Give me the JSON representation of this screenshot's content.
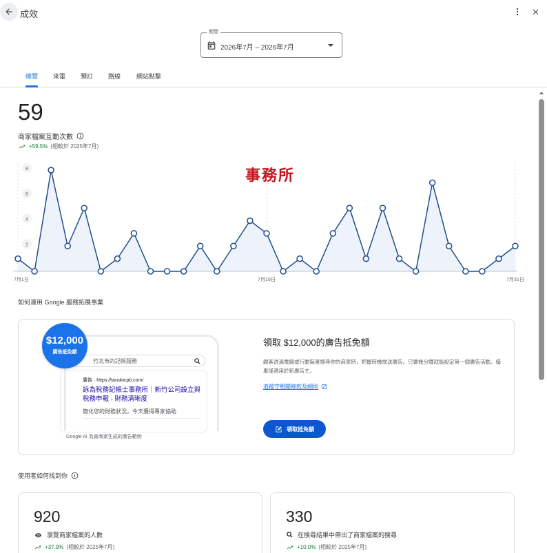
{
  "header": {
    "title": "成效"
  },
  "period": {
    "label": "期間",
    "value": "2026年7月 – 2026年7月"
  },
  "tabs": [
    {
      "label": "總覽"
    },
    {
      "label": "來電"
    },
    {
      "label": "預訂"
    },
    {
      "label": "路線"
    },
    {
      "label": "網站點擊"
    }
  ],
  "overview": {
    "total": "59",
    "label": "商家檔案互動次數",
    "change": "+59.5%",
    "comparison": "(相較於 2025年7月)"
  },
  "chart_data": {
    "type": "area",
    "x": [
      "7月1日",
      "7月2日",
      "7月3日",
      "7月4日",
      "7月5日",
      "7月6日",
      "7月7日",
      "7月8日",
      "7月9日",
      "7月10日",
      "7月11日",
      "7月12日",
      "7月13日",
      "7月14日",
      "7月15日",
      "7月16日",
      "7月17日",
      "7月18日",
      "7月19日",
      "7月20日",
      "7月21日",
      "7月22日",
      "7月23日",
      "7月24日",
      "7月25日",
      "7月26日",
      "7月27日",
      "7月28日",
      "7月29日",
      "7月30日",
      "7月31日",
      "8月1日"
    ],
    "values": [
      1,
      0,
      8,
      2,
      5,
      0,
      1,
      3,
      0,
      0,
      0,
      2,
      0,
      2,
      4,
      3,
      0,
      1,
      0,
      3,
      5,
      1,
      5,
      1,
      0,
      7,
      2,
      0,
      0,
      1,
      2
    ],
    "xticks": [
      "7月1日",
      "7月16日",
      "7月31日"
    ],
    "yticks": [
      "2",
      "4",
      "6",
      "8"
    ],
    "ylim": [
      0,
      8
    ],
    "annotation": "事務所",
    "color": "#1f4e8c"
  },
  "promo_section": {
    "title": "如何運用 Google 服務拓展事業",
    "badge_amount": "$12,000",
    "badge_sub": "廣告抵免額",
    "search_text": "竹北市的記帳服務",
    "ad_url": "廣告 · https://tanukicpb.com/",
    "ad_headline": "詠為稅務記帳士事務所｜新竹公司設立與稅務申報 - 財務清晰度",
    "ad_desc": "簡化您的財務狀況。今天獲得專家協助",
    "ad_caption": "Google AI 為貴商家生成的廣告範例",
    "heading": "領取 $12,000的廣告抵免額",
    "description": "顧客透過電腦或行動裝置搜尋你的商家時，把握時機放送廣告。只要幾分鐘就能設定第一個廣告活動。優惠僅適用於新廣告主。",
    "link": "追蹤守相關條款及細則",
    "button": "領取抵免額"
  },
  "discovery": {
    "title": "使用者如何找到你",
    "cards": [
      {
        "number": "920",
        "label": "瀏覽商家檔案的人數",
        "change": "+37.9%",
        "comparison": "(相較於 2025年7月)"
      },
      {
        "number": "330",
        "label": "在搜尋結果中帶出了商家檔案的搜尋",
        "change": "+10.0%",
        "comparison": "(相較於 2025年7月)"
      }
    ]
  },
  "colors": {
    "accent": "#1a73e8",
    "positive": "#188038",
    "button": "#0b57d0"
  }
}
